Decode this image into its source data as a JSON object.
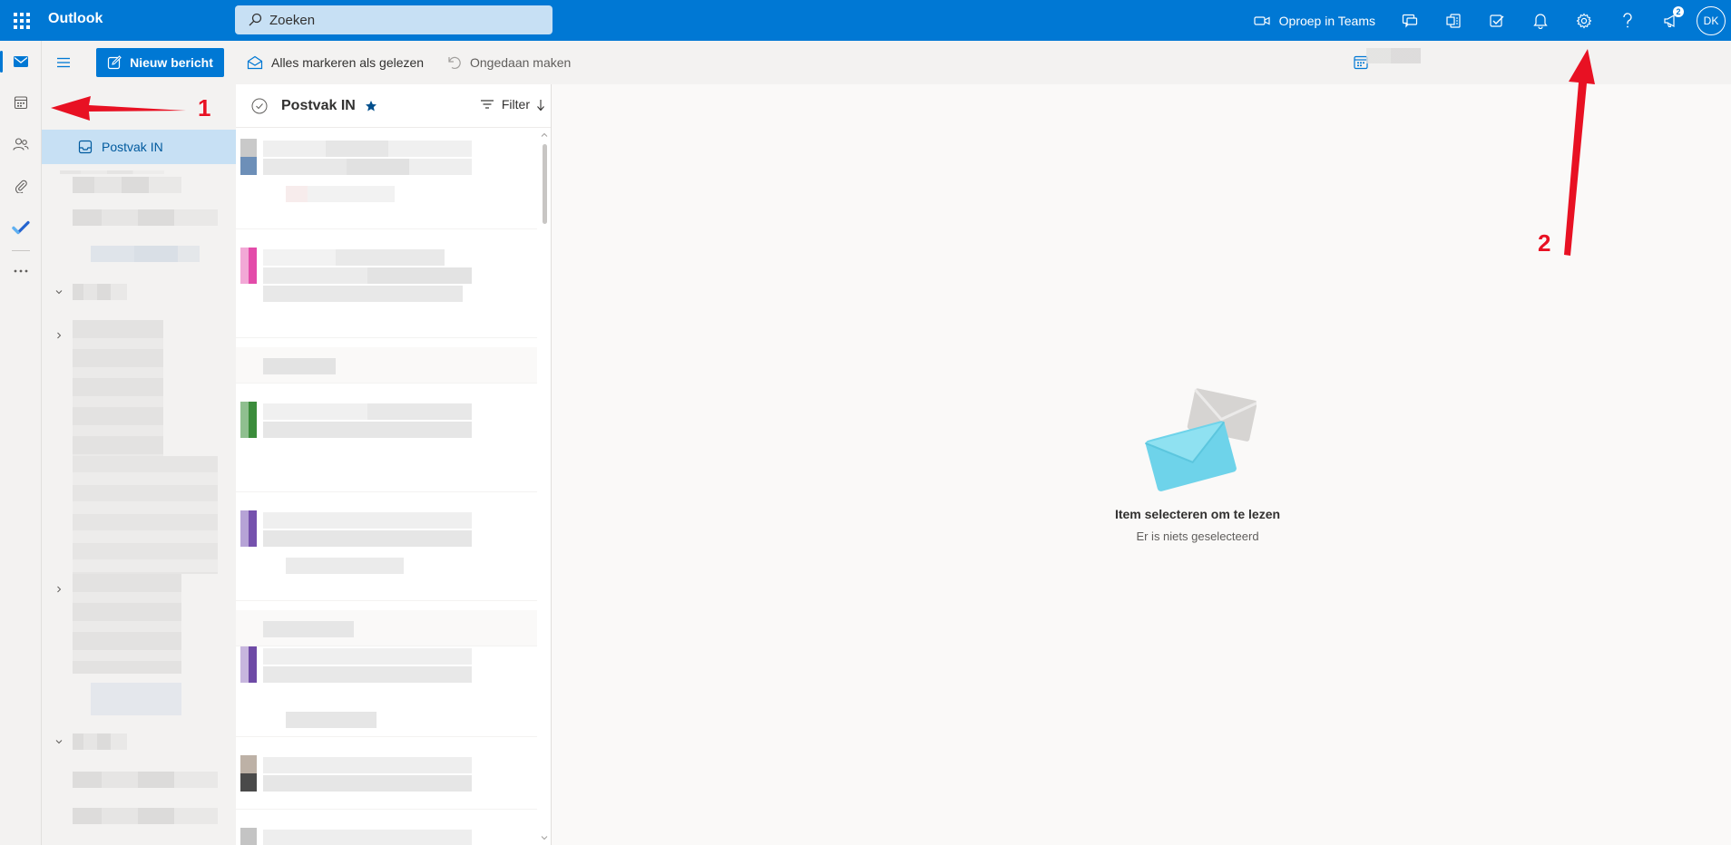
{
  "app": {
    "title": "Outlook"
  },
  "search": {
    "placeholder": "Zoeken"
  },
  "topbar": {
    "teams_label": "Oproep in Teams",
    "notification_badge": "2",
    "avatar_initials": "DK",
    "accent_color": "#0078d4"
  },
  "commandbar": {
    "new_message_label": "Nieuw bericht",
    "mark_all_read_label": "Alles markeren als gelezen",
    "undo_label": "Ongedaan maken"
  },
  "folders": {
    "inbox_label": "Postvak IN"
  },
  "messagelist": {
    "title": "Postvak IN",
    "filter_label": "Filter"
  },
  "reading": {
    "empty_title": "Item selecteren om te lezen",
    "empty_subtitle": "Er is niets geselecteerd"
  },
  "annotations": {
    "arrow1_label": "1",
    "arrow2_label": "2",
    "arrow_color": "#e81123"
  }
}
